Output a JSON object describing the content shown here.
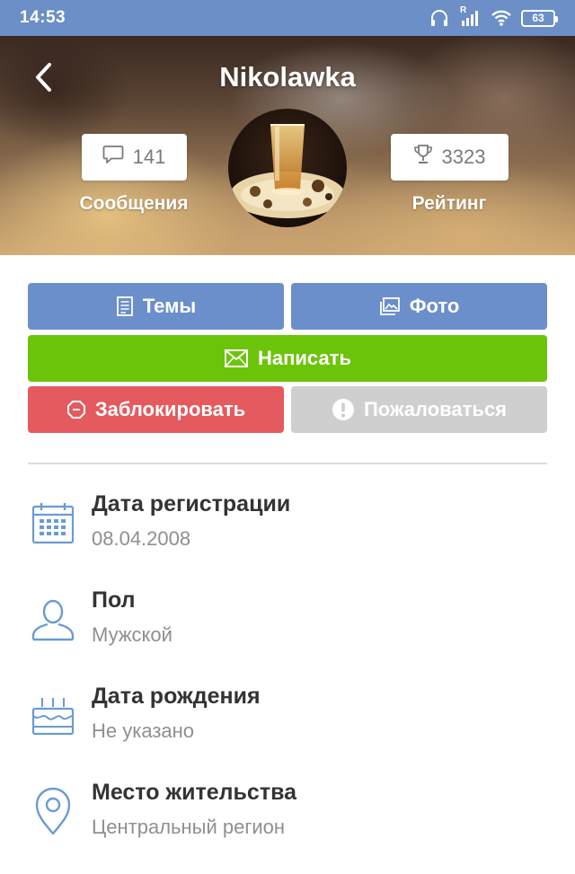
{
  "status_bar": {
    "time": "14:53",
    "battery": "63",
    "signal_label": "R"
  },
  "header": {
    "title": "Nikolawka"
  },
  "stats": {
    "messages": {
      "count": "141",
      "label": "Сообщения"
    },
    "rating": {
      "count": "3323",
      "label": "Рейтинг"
    }
  },
  "actions": {
    "themes": "Темы",
    "photo": "Фото",
    "write": "Написать",
    "block": "Заблокировать",
    "report": "Пожаловаться"
  },
  "info": [
    {
      "title": "Дата регистрации",
      "value": "08.04.2008",
      "icon": "calendar-icon"
    },
    {
      "title": "Пол",
      "value": "Мужской",
      "icon": "person-icon"
    },
    {
      "title": "Дата рождения",
      "value": "Не указано",
      "icon": "cake-icon"
    },
    {
      "title": "Место жительства",
      "value": "Центральный регион",
      "icon": "location-pin-icon"
    }
  ],
  "colors": {
    "status_bar": "#6b8fc6",
    "primary": "#6b8fcb",
    "success": "#6cc40a",
    "danger": "#e55a5e",
    "disabled": "#cfcfcf",
    "icon": "#6b9bd2"
  }
}
